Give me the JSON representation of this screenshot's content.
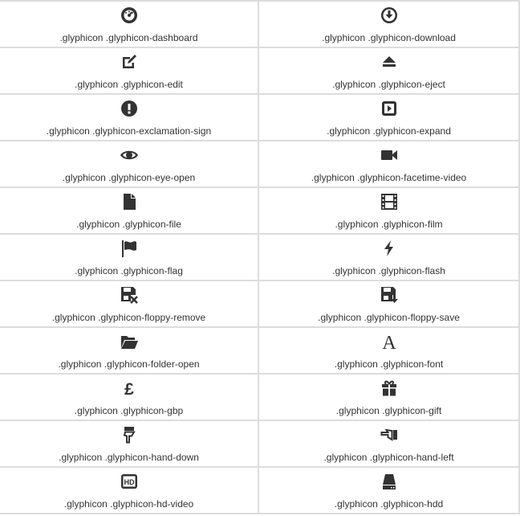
{
  "icon_color": "#333333",
  "border_color": "#dddddd",
  "cells": [
    {
      "label": ".glyphicon .glyphicon-dashboard",
      "icon": "dashboard-icon"
    },
    {
      "label": ".glyphicon .glyphicon-download",
      "icon": "download-icon"
    },
    {
      "label": ".glyphicon .glyphicon-edit",
      "icon": "edit-icon"
    },
    {
      "label": ".glyphicon .glyphicon-eject",
      "icon": "eject-icon"
    },
    {
      "label": ".glyphicon .glyphicon-exclamation-sign",
      "icon": "exclamation-sign-icon"
    },
    {
      "label": ".glyphicon .glyphicon-expand",
      "icon": "expand-icon"
    },
    {
      "label": ".glyphicon .glyphicon-eye-open",
      "icon": "eye-open-icon"
    },
    {
      "label": ".glyphicon .glyphicon-facetime-video",
      "icon": "facetime-video-icon"
    },
    {
      "label": ".glyphicon .glyphicon-file",
      "icon": "file-icon"
    },
    {
      "label": ".glyphicon .glyphicon-film",
      "icon": "film-icon"
    },
    {
      "label": ".glyphicon .glyphicon-flag",
      "icon": "flag-icon"
    },
    {
      "label": ".glyphicon .glyphicon-flash",
      "icon": "flash-icon"
    },
    {
      "label": ".glyphicon .glyphicon-floppy-remove",
      "icon": "floppy-remove-icon"
    },
    {
      "label": ".glyphicon .glyphicon-floppy-save",
      "icon": "floppy-save-icon"
    },
    {
      "label": ".glyphicon .glyphicon-folder-open",
      "icon": "folder-open-icon"
    },
    {
      "label": ".glyphicon .glyphicon-font",
      "icon": "font-icon"
    },
    {
      "label": ".glyphicon .glyphicon-gbp",
      "icon": "gbp-icon"
    },
    {
      "label": ".glyphicon .glyphicon-gift",
      "icon": "gift-icon"
    },
    {
      "label": ".glyphicon .glyphicon-hand-down",
      "icon": "hand-down-icon"
    },
    {
      "label": ".glyphicon .glyphicon-hand-left",
      "icon": "hand-left-icon"
    },
    {
      "label": ".glyphicon .glyphicon-hd-video",
      "icon": "hd-video-icon"
    },
    {
      "label": ".glyphicon .glyphicon-hdd",
      "icon": "hdd-icon"
    }
  ]
}
